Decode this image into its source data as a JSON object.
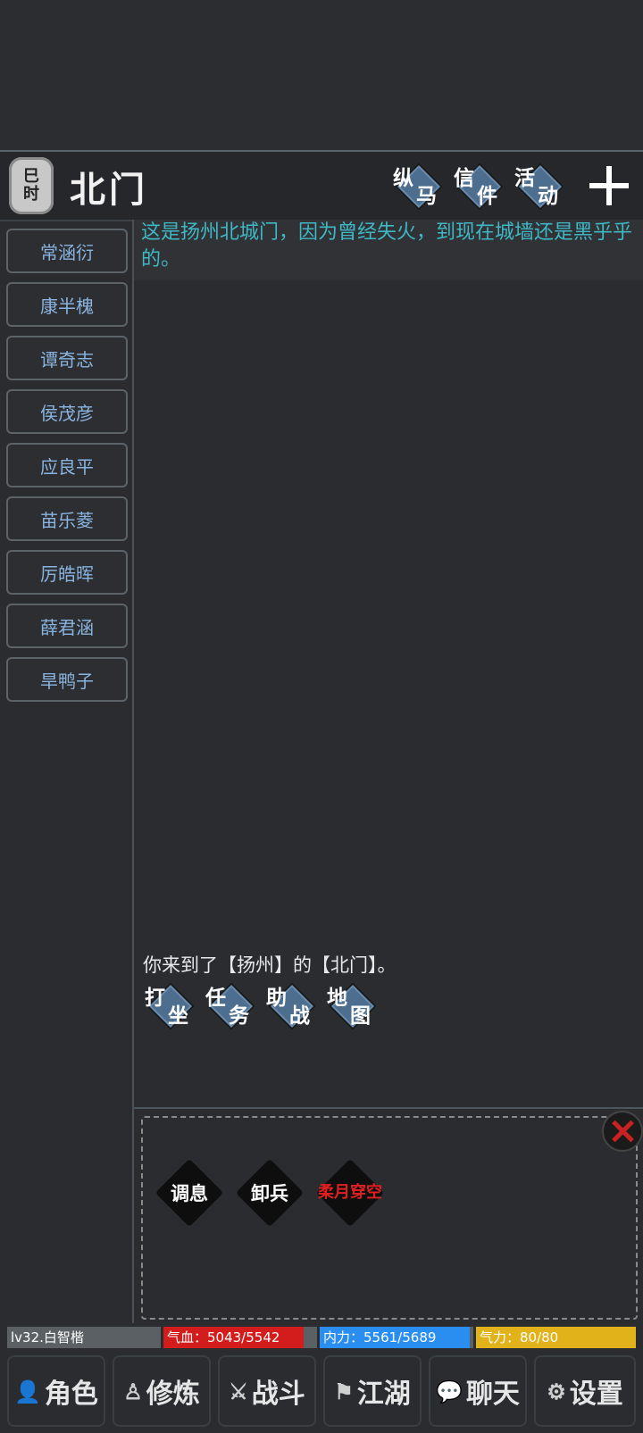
{
  "header": {
    "time_char_1": "巳",
    "time_char_2": "时",
    "location": "北门",
    "tags": [
      {
        "c1": "纵",
        "c2": "马"
      },
      {
        "c1": "信",
        "c2": "件"
      },
      {
        "c1": "活",
        "c2": "动"
      }
    ]
  },
  "npcs": [
    "常涵衍",
    "康半槐",
    "谭奇志",
    "侯茂彦",
    "应良平",
    "苗乐菱",
    "厉皓晖",
    "薛君涵",
    "旱鸭子"
  ],
  "description": "这是扬州北城门，因为曾经失火，到现在城墙还是黑乎乎的。",
  "log_message": "你来到了【扬州】的【北门】。",
  "actions": [
    {
      "c1": "打",
      "c2": "坐"
    },
    {
      "c1": "任",
      "c2": "务"
    },
    {
      "c1": "助",
      "c2": "战"
    },
    {
      "c1": "地",
      "c2": "图"
    }
  ],
  "skills": [
    {
      "label": "调息"
    },
    {
      "label": "卸兵"
    },
    {
      "label_l1": "柔月",
      "label_l2": "穿空"
    }
  ],
  "status": {
    "name": "lv32.白智楷",
    "hp_text": "气血：5043/5542",
    "hp_fraction": 0.91,
    "mp_text": "内力：5561/5689",
    "mp_fraction": 0.977,
    "qi_text": "气力：80/80",
    "qi_fraction": 1.0
  },
  "nav": [
    {
      "label": "角色",
      "icon": "person-icon"
    },
    {
      "label": "修炼",
      "icon": "meditate-icon"
    },
    {
      "label": "战斗",
      "icon": "sword-icon"
    },
    {
      "label": "江湖",
      "icon": "flag-icon"
    },
    {
      "label": "聊天",
      "icon": "chat-icon"
    },
    {
      "label": "设置",
      "icon": "gear-icon"
    }
  ],
  "colors": {
    "background": "#2a2c2f",
    "npc_text": "#8ab4e0",
    "description_text": "#3fb8c6",
    "hp": "#d31c1c",
    "mp": "#2a8ef0",
    "qi": "#e2b21a"
  }
}
